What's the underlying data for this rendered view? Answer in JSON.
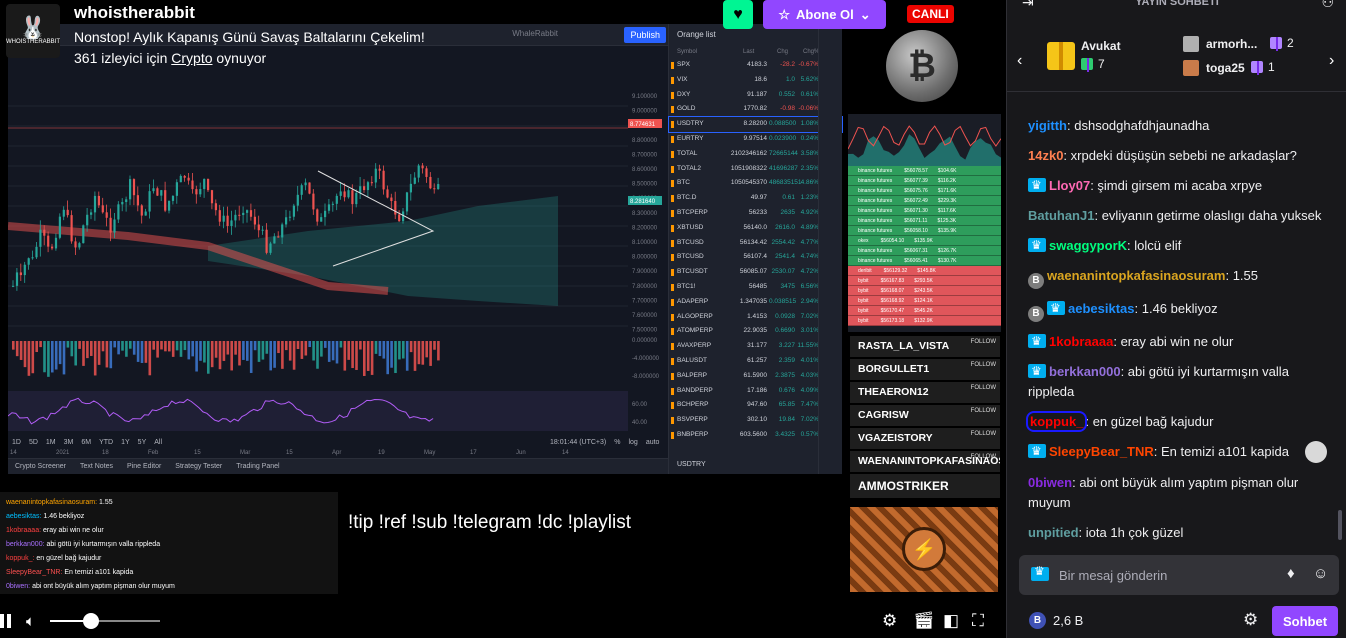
{
  "stream": {
    "streamer": "whoistherabbit",
    "avatar_brand": "WHOISTHERABBIT",
    "title": "Nonstop! Aylık Kapanış Günü Savaş Baltalarını Çekelim!",
    "viewers_prefix": "361 izleyici için",
    "game": "Crypto",
    "viewers_suffix": "oynuyor",
    "subscribe_label": "Abone Ol",
    "live_label": "CANLI",
    "commands_text": "!tip !ref !sub !telegram !dc !playlist",
    "volume_level": 0.37
  },
  "tradingview": {
    "layout_name": "WhaleRabbit",
    "publish_label": "Publish",
    "ticker": "BTCUSDT",
    "pair_label": "Turkey",
    "price_tags": [
      "8.774631",
      "8.281640"
    ],
    "y_axis": [
      "9.100000",
      "9.000000",
      "8.900000",
      "8.800000",
      "8.700000",
      "8.600000",
      "8.500000",
      "8.400000",
      "8.300000",
      "8.200000",
      "8.100000",
      "8.000000",
      "7.900000",
      "7.800000",
      "7.700000",
      "7.600000",
      "7.500000",
      "0.000000",
      "-4.000000",
      "-8.000000",
      "60.00",
      "40.00"
    ],
    "x_axis": [
      "14",
      "2021",
      "18",
      "Feb",
      "15",
      "Mar",
      "15",
      "Apr",
      "19",
      "May",
      "17",
      "Jun",
      "14"
    ],
    "ranges": [
      "1D",
      "5D",
      "1M",
      "3M",
      "6M",
      "YTD",
      "1Y",
      "5Y",
      "All"
    ],
    "clock": "18:01:44 (UTC+3)",
    "scale_opts": [
      "%",
      "log",
      "auto"
    ],
    "bottom_tabs": [
      "Crypto Screener",
      "Text Notes",
      "Pine Editor",
      "Strategy Tester",
      "Trading Panel"
    ]
  },
  "watchlist": {
    "title": "Orange list",
    "headers": [
      "Symbol",
      "Last",
      "Chg",
      "Chg%"
    ],
    "rows": [
      {
        "sym": "SPX",
        "last": "4183.3",
        "chg": "-28.2",
        "pct": "-0.67%",
        "up": false
      },
      {
        "sym": "VIX",
        "last": "18.6",
        "chg": "1.0",
        "pct": "5.62%",
        "up": true
      },
      {
        "sym": "DXY",
        "last": "91.187",
        "chg": "0.552",
        "pct": "0.61%",
        "up": true
      },
      {
        "sym": "GOLD",
        "last": "1770.82",
        "chg": "-0.98",
        "pct": "-0.06%",
        "up": false
      },
      {
        "sym": "USDTRY",
        "last": "8.28200",
        "chg": "0.088500",
        "pct": "1.08%",
        "up": true
      },
      {
        "sym": "EURTRY",
        "last": "9.97514",
        "chg": "0.023900",
        "pct": "0.24%",
        "up": true
      },
      {
        "sym": "TOTAL",
        "last": "2102346162",
        "chg": "72665144",
        "pct": "3.58%",
        "up": true
      },
      {
        "sym": "TOTAL2",
        "last": "1051908322",
        "chg": "41696287",
        "pct": "2.35%",
        "up": true
      },
      {
        "sym": "BTC",
        "last": "1050545370",
        "chg": "486835151",
        "pct": "4.86%",
        "up": true
      },
      {
        "sym": "BTC.D",
        "last": "49.97",
        "chg": "0.61",
        "pct": "1.23%",
        "up": true
      },
      {
        "sym": "BTCPERP",
        "last": "56233",
        "chg": "2635",
        "pct": "4.92%",
        "up": true
      },
      {
        "sym": "XBTUSD",
        "last": "56140.0",
        "chg": "2616.0",
        "pct": "4.89%",
        "up": true
      },
      {
        "sym": "BTCUSD",
        "last": "56134.42",
        "chg": "2554.42",
        "pct": "4.77%",
        "up": true
      },
      {
        "sym": "BTCUSD",
        "last": "56107.4",
        "chg": "2541.4",
        "pct": "4.74%",
        "up": true
      },
      {
        "sym": "BTCUSDT",
        "last": "56085.07",
        "chg": "2530.07",
        "pct": "4.72%",
        "up": true
      },
      {
        "sym": "BTC1!",
        "last": "56485",
        "chg": "3475",
        "pct": "6.56%",
        "up": true
      },
      {
        "sym": "ADAPERP",
        "last": "1.347035",
        "chg": "0.038515",
        "pct": "2.94%",
        "up": true
      },
      {
        "sym": "ALGOPERP",
        "last": "1.4153",
        "chg": "0.0928",
        "pct": "7.02%",
        "up": true
      },
      {
        "sym": "ATOMPERP",
        "last": "22.9035",
        "chg": "0.6690",
        "pct": "3.01%",
        "up": true
      },
      {
        "sym": "AVAXPERP",
        "last": "31.177",
        "chg": "3.227",
        "pct": "11.55%",
        "up": true
      },
      {
        "sym": "BALUSDT",
        "last": "61.257",
        "chg": "2.359",
        "pct": "4.01%",
        "up": true
      },
      {
        "sym": "BALPERP",
        "last": "61.5900",
        "chg": "2.3875",
        "pct": "4.03%",
        "up": true
      },
      {
        "sym": "BANDPERP",
        "last": "17.186",
        "chg": "0.676",
        "pct": "4.09%",
        "up": true
      },
      {
        "sym": "BCHPERP",
        "last": "947.60",
        "chg": "65.85",
        "pct": "7.47%",
        "up": true
      },
      {
        "sym": "BSVPERP",
        "last": "302.10",
        "chg": "19.84",
        "pct": "7.02%",
        "up": true
      },
      {
        "sym": "BNBPERP",
        "last": "603.5600",
        "chg": "3.4325",
        "pct": "0.57%",
        "up": true
      }
    ],
    "footer_symbol": "USDTRY"
  },
  "depth_feed": {
    "rows": [
      {
        "src": "binance futures",
        "price": "$56078.57",
        "size": "$104.6K",
        "side": "buy"
      },
      {
        "src": "binance futures",
        "price": "$56077.39",
        "size": "$116.2K",
        "side": "buy"
      },
      {
        "src": "binance futures",
        "price": "$56075.76",
        "size": "$171.6K",
        "side": "buy"
      },
      {
        "src": "binance futures",
        "price": "$56072.49",
        "size": "$229.3K",
        "side": "buy"
      },
      {
        "src": "binance futures",
        "price": "$56071.30",
        "size": "$117.6K",
        "side": "buy"
      },
      {
        "src": "binance futures",
        "price": "$56071.11",
        "size": "$125.3K",
        "side": "buy"
      },
      {
        "src": "binance futures",
        "price": "$56058.10",
        "size": "$135.9K",
        "side": "buy"
      },
      {
        "src": "okex",
        "price": "$56054.10",
        "size": "$135.9K",
        "side": "buy"
      },
      {
        "src": "binance futures",
        "price": "$56067.31",
        "size": "$126.7K",
        "side": "buy"
      },
      {
        "src": "binance futures",
        "price": "$56065.41",
        "size": "$130.7K",
        "side": "buy"
      },
      {
        "src": "deribit",
        "price": "$56129.32",
        "size": "$145.8K",
        "side": "sell"
      },
      {
        "src": "bybit",
        "price": "$56167.83",
        "size": "$293.5K",
        "side": "sell"
      },
      {
        "src": "bybit",
        "price": "$56168.07",
        "size": "$243.5K",
        "side": "sell"
      },
      {
        "src": "bybit",
        "price": "$56168.92",
        "size": "$124.1K",
        "side": "sell"
      },
      {
        "src": "bybit",
        "price": "$56170.47",
        "size": "$545.2K",
        "side": "sell"
      },
      {
        "src": "bybit",
        "price": "$56173.18",
        "size": "$132.9K",
        "side": "sell"
      }
    ]
  },
  "recent_followers": {
    "names": [
      "RASTA_LA_VISTA",
      "BORGULLET1",
      "THEAERON12",
      "CAGRISW",
      "VGAZEISTORY",
      "WAENANINTOPKAFASINAOSURAM",
      "AMMOSTRIKER"
    ],
    "follow_tag": "FOLLOW"
  },
  "overlay_chat": [
    {
      "user": "waenanintopkafasinaosuram:",
      "text": "1.55",
      "color": "#ffa500"
    },
    {
      "user": "aebesiktas:",
      "text": "1.46 bekliyoz",
      "color": "#00bfff"
    },
    {
      "user": "1kobraaaa:",
      "text": "eray abi win ne olur",
      "color": "#ff4040"
    },
    {
      "user": "berkkan000:",
      "text": "abi götü iyi kurtarmışın valla rippleda",
      "color": "#a970ff"
    },
    {
      "user": "koppuk_:",
      "text": "en güzel bağ kajudur",
      "color": "#ff4040"
    },
    {
      "user": "SleepyBear_TNR:",
      "text": "En temizi a101 kapida",
      "color": "#ff5050"
    },
    {
      "user": "0biwen:",
      "text": "abi ont büyük alım yaptım pişman olur muyum",
      "color": "#a970ff"
    }
  ],
  "chat": {
    "title": "YAYIN SOHBETİ",
    "leaderboard": {
      "first": {
        "name": "Avukat",
        "count": "7"
      },
      "second": {
        "name": "armorh...",
        "count": "2"
      },
      "third": {
        "name": "toga25",
        "count": "1"
      }
    },
    "messages": [
      {
        "user": "yigitth",
        "color": "#1e90ff",
        "text": "dshsodghafdhjaunadha",
        "badge": ""
      },
      {
        "user": "14zk0",
        "color": "#ff7f50",
        "text": "xrpdeki düşüşün sebebi ne arkadaşlar?",
        "badge": ""
      },
      {
        "user": "Lloy07",
        "color": "#ff69b4",
        "text": "şimdi girsem mi acaba xrpye",
        "badge": "crown"
      },
      {
        "user": "BatuhanJ1",
        "color": "#5f9ea0",
        "text": "evliyanın getirme olaslıgı daha yuksek",
        "badge": ""
      },
      {
        "user": "swaggyporK",
        "color": "#00ff7f",
        "text": "lolcü elif",
        "badge": "crown"
      },
      {
        "user": "waenanintopkafasinaosuram",
        "color": "#daa520",
        "text": "1.55",
        "badge": "coin"
      },
      {
        "user": "aebesiktas",
        "color": "#1e90ff",
        "text": "1.46 bekliyoz",
        "badge": "coin-crown"
      },
      {
        "user": "1kobraaaa",
        "color": "#ff0000",
        "text": "eray abi win ne olur",
        "badge": "crown"
      },
      {
        "user": "berkkan000",
        "color": "#9370db",
        "text": "abi götü iyi kurtarmışın valla rippleda",
        "badge": "crown"
      },
      {
        "user": "koppuk_",
        "color": "#ff0000",
        "text": "en güzel bağ kajudur",
        "badge": "circled"
      },
      {
        "user": "SleepyBear_TNR",
        "color": "#ff4500",
        "text": "En temizi a101 kapida",
        "badge": "crown-emote"
      },
      {
        "user": "0biwen",
        "color": "#8a2be2",
        "text": "abi ont büyük alım yaptım pişman olur muyum",
        "badge": ""
      },
      {
        "user": "unpitied",
        "color": "#5f9ea0",
        "text": "iota 1h çok güzel",
        "badge": ""
      }
    ],
    "input_placeholder": "Bir mesaj gönderin",
    "points": "2,6 B",
    "send_label": "Sohbet"
  },
  "colors": {
    "twitch_purple": "#9147ff",
    "live_red": "#eb0400",
    "heart_green": "#00f593",
    "tv_background": "#131722",
    "up_green": "#26a69a",
    "down_red": "#ef5350"
  }
}
